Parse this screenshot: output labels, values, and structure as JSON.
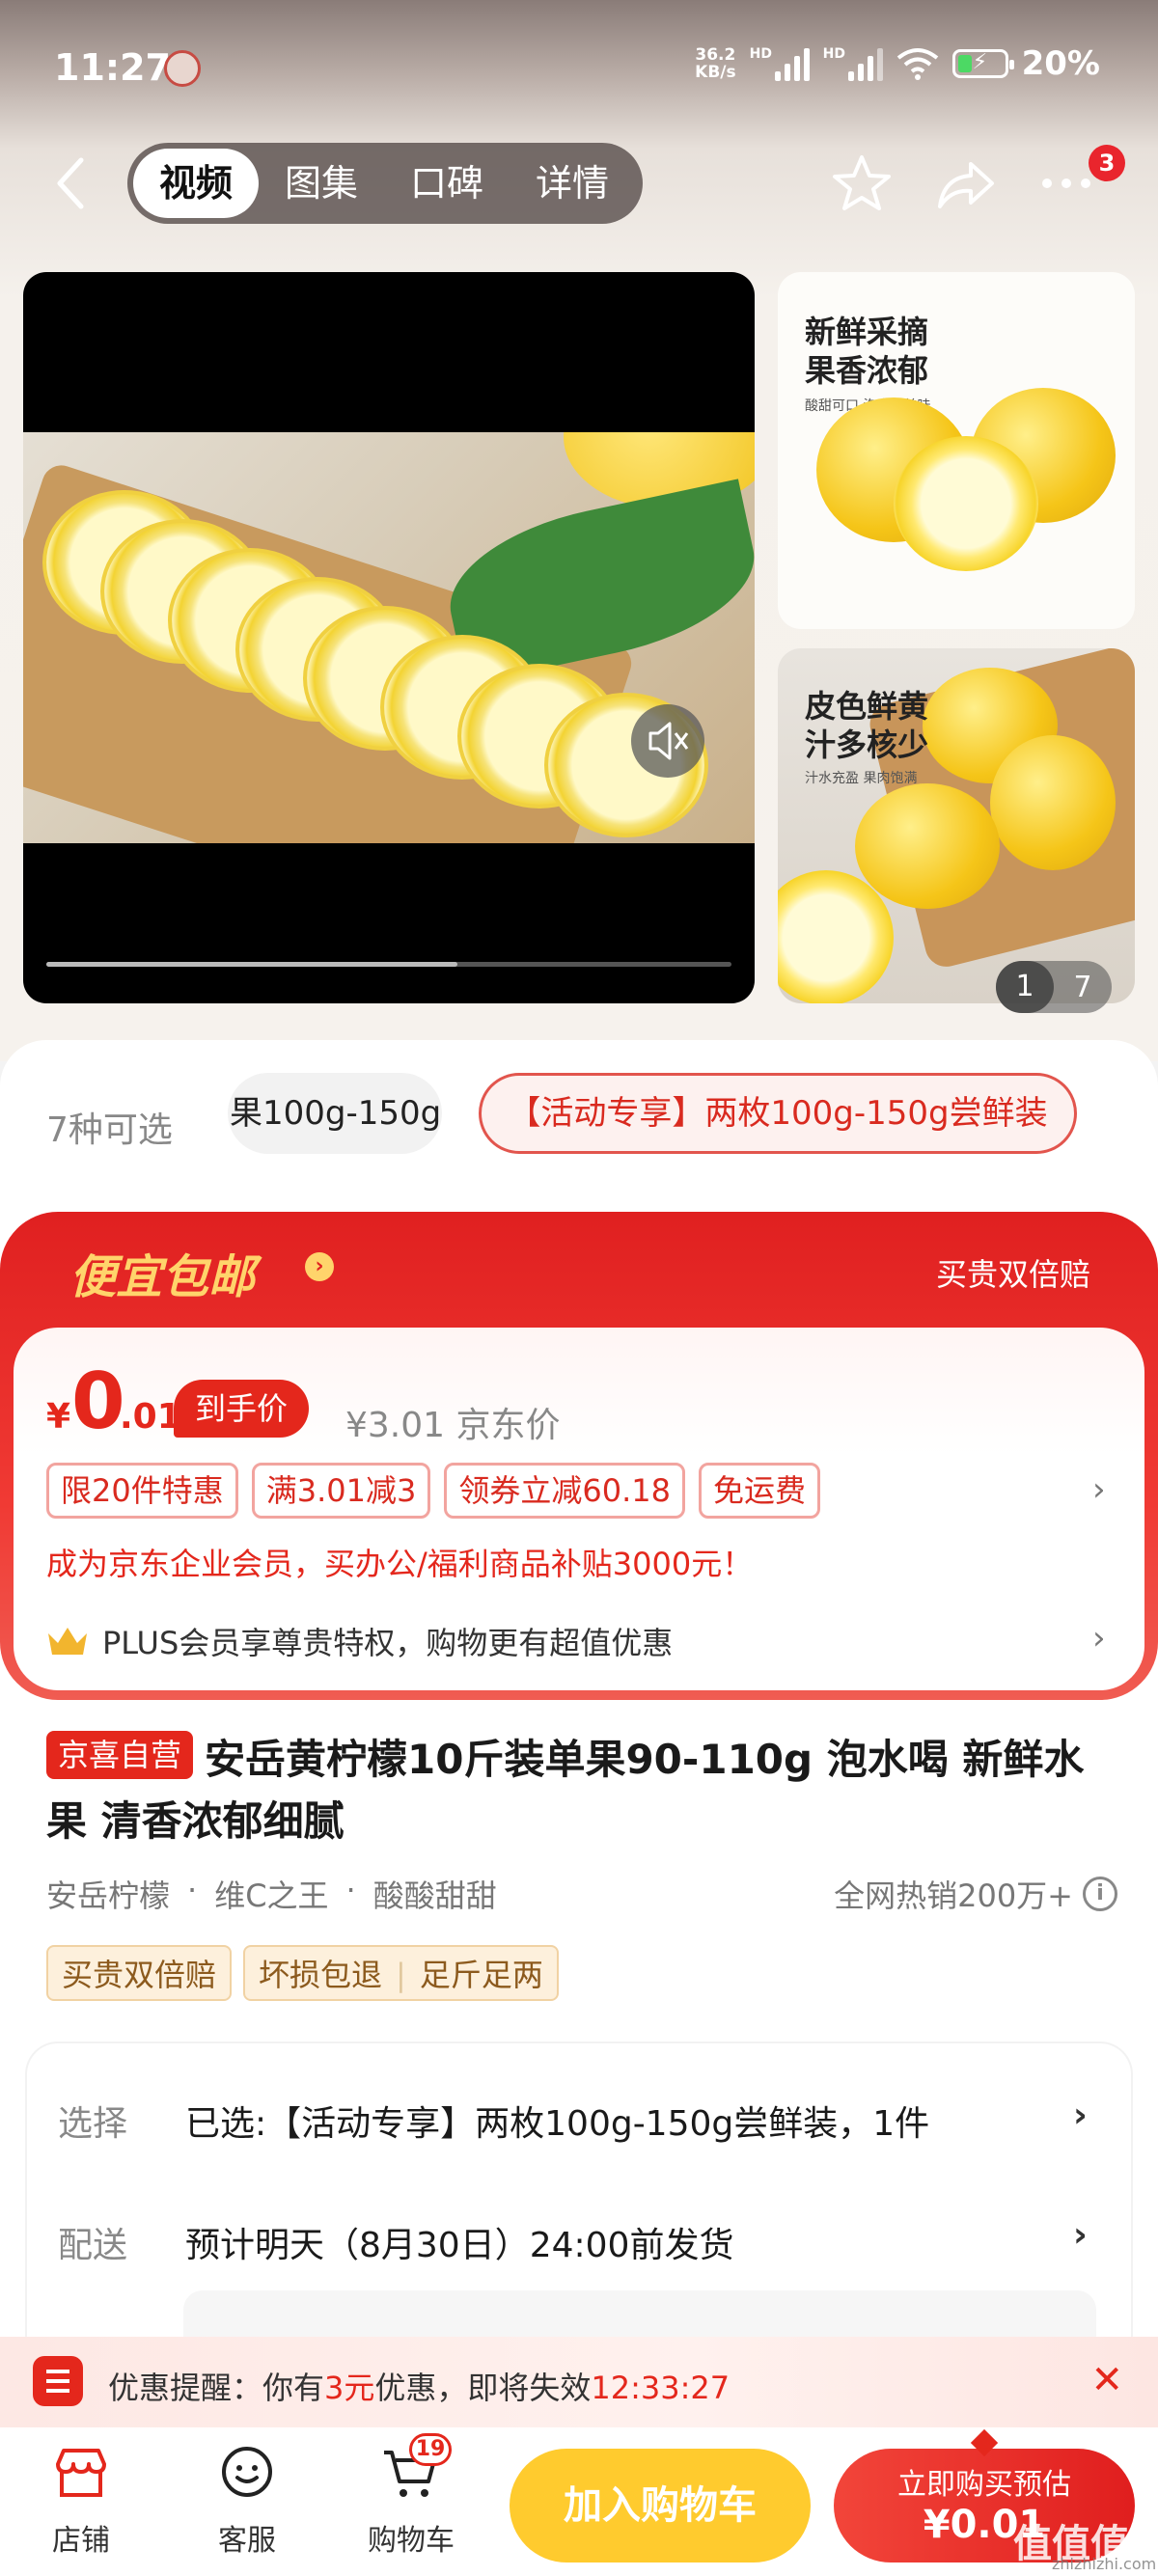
{
  "status_bar": {
    "time": "11:27",
    "net_speed_value": "36.2",
    "net_speed_unit": "KB/s",
    "signal_label": "HD",
    "battery": "20%"
  },
  "nav": {
    "tabs": [
      {
        "label": "视频",
        "active": true
      },
      {
        "label": "图集",
        "active": false
      },
      {
        "label": "口碑",
        "active": false
      },
      {
        "label": "详情",
        "active": false
      }
    ],
    "more_badge": "3",
    "icons": [
      "back-arrow-icon",
      "star-icon",
      "share-icon",
      "more-icon"
    ]
  },
  "media": {
    "video_progress": 0.6,
    "thumb1": {
      "title_line1": "新鲜采摘",
      "title_line2": "果香浓郁",
      "sub": "酸甜可口 泡水更美味"
    },
    "thumb2": {
      "title_line1": "皮色鲜黄",
      "title_line2": "汁多核少",
      "sub": "汁水充盈 果肉饱满"
    },
    "counter_current": "1",
    "counter_total": "7"
  },
  "variants": {
    "count_label": "7种可选",
    "chip1": "果100g-150g",
    "chip2": "【活动专享】两枚100g-150g尝鲜装"
  },
  "promo": {
    "title": "便宜包邮",
    "guarantee": "买贵双倍赔",
    "price_yen": "¥",
    "price_int": "0",
    "price_dec": ".01",
    "price_tag": "到手价",
    "jd_price": "¥3.01 京东价",
    "coupons": [
      "限20件特惠",
      "满3.01减3",
      "领券立减60.18",
      "免运费"
    ],
    "enterprise": "成为京东企业会员，买办公/福利商品补贴3000元！",
    "plus": "PLUS会员享尊贵特权，购物更有超值优惠"
  },
  "product": {
    "badge": "京喜自营",
    "title": "安岳黄柠檬10斤装单果90-110g 泡水喝 新鲜水果 清香浓郁细腻",
    "tags": [
      "安岳柠檬",
      "维C之王",
      "酸酸甜甜"
    ],
    "hot_sales": "全网热销200万+",
    "guarantees": [
      "买贵双倍赔",
      "坏损包退",
      "足斤足两"
    ]
  },
  "selection": {
    "select_label": "选择",
    "select_value": "已选:【活动专享】两枚100g-150g尝鲜装，1件",
    "delivery_label": "配送",
    "delivery_value": "预计明天（8月30日）24:00前发货"
  },
  "reminder": {
    "prefix": "优惠提醒：你有",
    "amount": "3元",
    "suffix": "优惠，即将失效",
    "countdown": "12:33:27"
  },
  "bottom_bar": {
    "shop": "店铺",
    "service": "客服",
    "cart": "购物车",
    "cart_count": "19",
    "add_cart": "加入购物车",
    "buy_now_line1": "立即购买预估",
    "buy_now_line2": "¥0.01"
  },
  "watermark": {
    "main": "值值值",
    "sub": "zhizhizhi.com"
  },
  "colors": {
    "accent": "#e4271c",
    "gold": "#ffd46b",
    "add_cart": "#ffcb2e"
  }
}
